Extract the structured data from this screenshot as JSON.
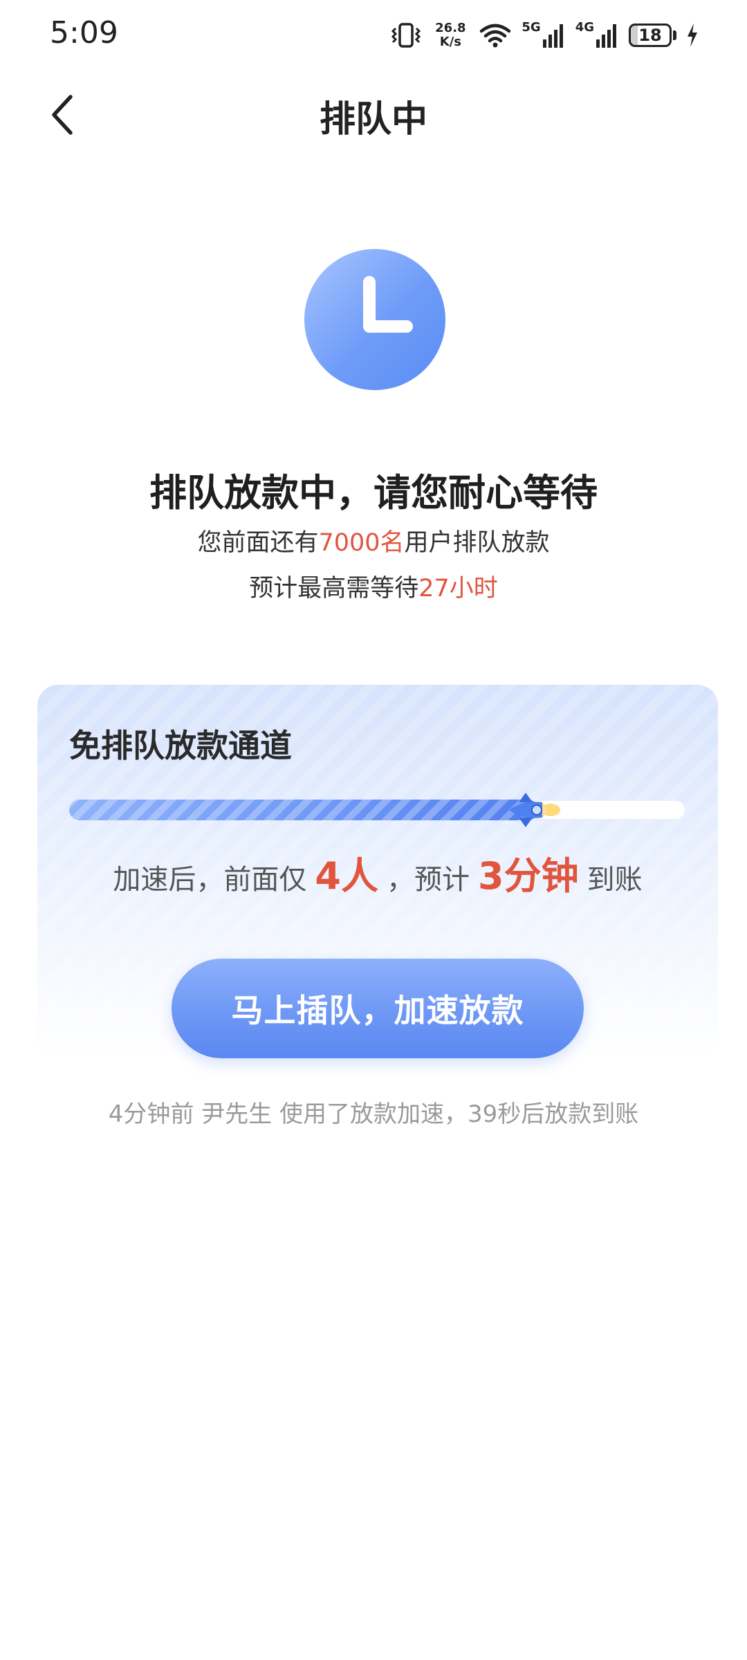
{
  "status_bar": {
    "time": "5:09",
    "net_speed_value": "26.8",
    "net_speed_unit": "K/s",
    "signal_1_label": "5G",
    "signal_2_label": "4G",
    "battery_level": "18"
  },
  "nav": {
    "title": "排队中"
  },
  "queue": {
    "main_title": "排队放款中，请您耐心等待",
    "ahead_prefix": "您前面还有",
    "ahead_count": "7000名",
    "ahead_suffix": "用户排队放款",
    "wait_prefix": "预计最高需等待",
    "wait_time": "27小时"
  },
  "fast_channel": {
    "title": "免排队放款通道",
    "progress_percent": 76,
    "accel_prefix": "加速后，前面仅",
    "accel_people": "4人",
    "accel_middle": "，预计",
    "accel_time": "3分钟",
    "accel_suffix": "到账",
    "cta_label": "马上插队，加速放款"
  },
  "footer": {
    "note": "4分钟前 尹先生 使用了放款加速，39秒后放款到账"
  },
  "colors": {
    "accent_blue": "#5b87f1",
    "highlight_red": "#e1553e"
  }
}
